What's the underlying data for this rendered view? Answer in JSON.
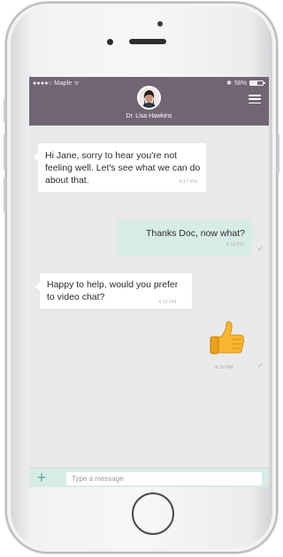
{
  "status_bar": {
    "carrier": "●●●●○ Maple ᯤ",
    "battery_percent_label": "58%",
    "battery_level": 0.58,
    "bluetooth_icon": "bluetooth-icon"
  },
  "header": {
    "contact_name": "Dr. Lisa Hawkins",
    "menu_icon": "hamburger-menu-icon",
    "background_color": "#716574"
  },
  "messages": [
    {
      "direction": "incoming",
      "text": "Hi Jane, sorry to hear you're not feeling well. Let's see what we can do about that.",
      "time": "4:17 PM"
    },
    {
      "direction": "outgoing",
      "text": "Thanks Doc, now what?",
      "time": "4:18 PM",
      "status_icon": "check-icon"
    },
    {
      "direction": "incoming",
      "text": "Happy to help, would you prefer to video chat?",
      "time": "4:19 PM"
    },
    {
      "direction": "outgoing",
      "emoji": "thumbs-up",
      "time": "4:19 PM",
      "status_icon": "check-icon"
    }
  ],
  "composer": {
    "add_icon": "plus-icon",
    "placeholder": "Type a message",
    "value": ""
  },
  "colors": {
    "accent": "#5ba89a",
    "outgoing_bubble": "#d8ece7",
    "incoming_bubble": "#ffffff",
    "screen_background": "#e9e9ea"
  }
}
